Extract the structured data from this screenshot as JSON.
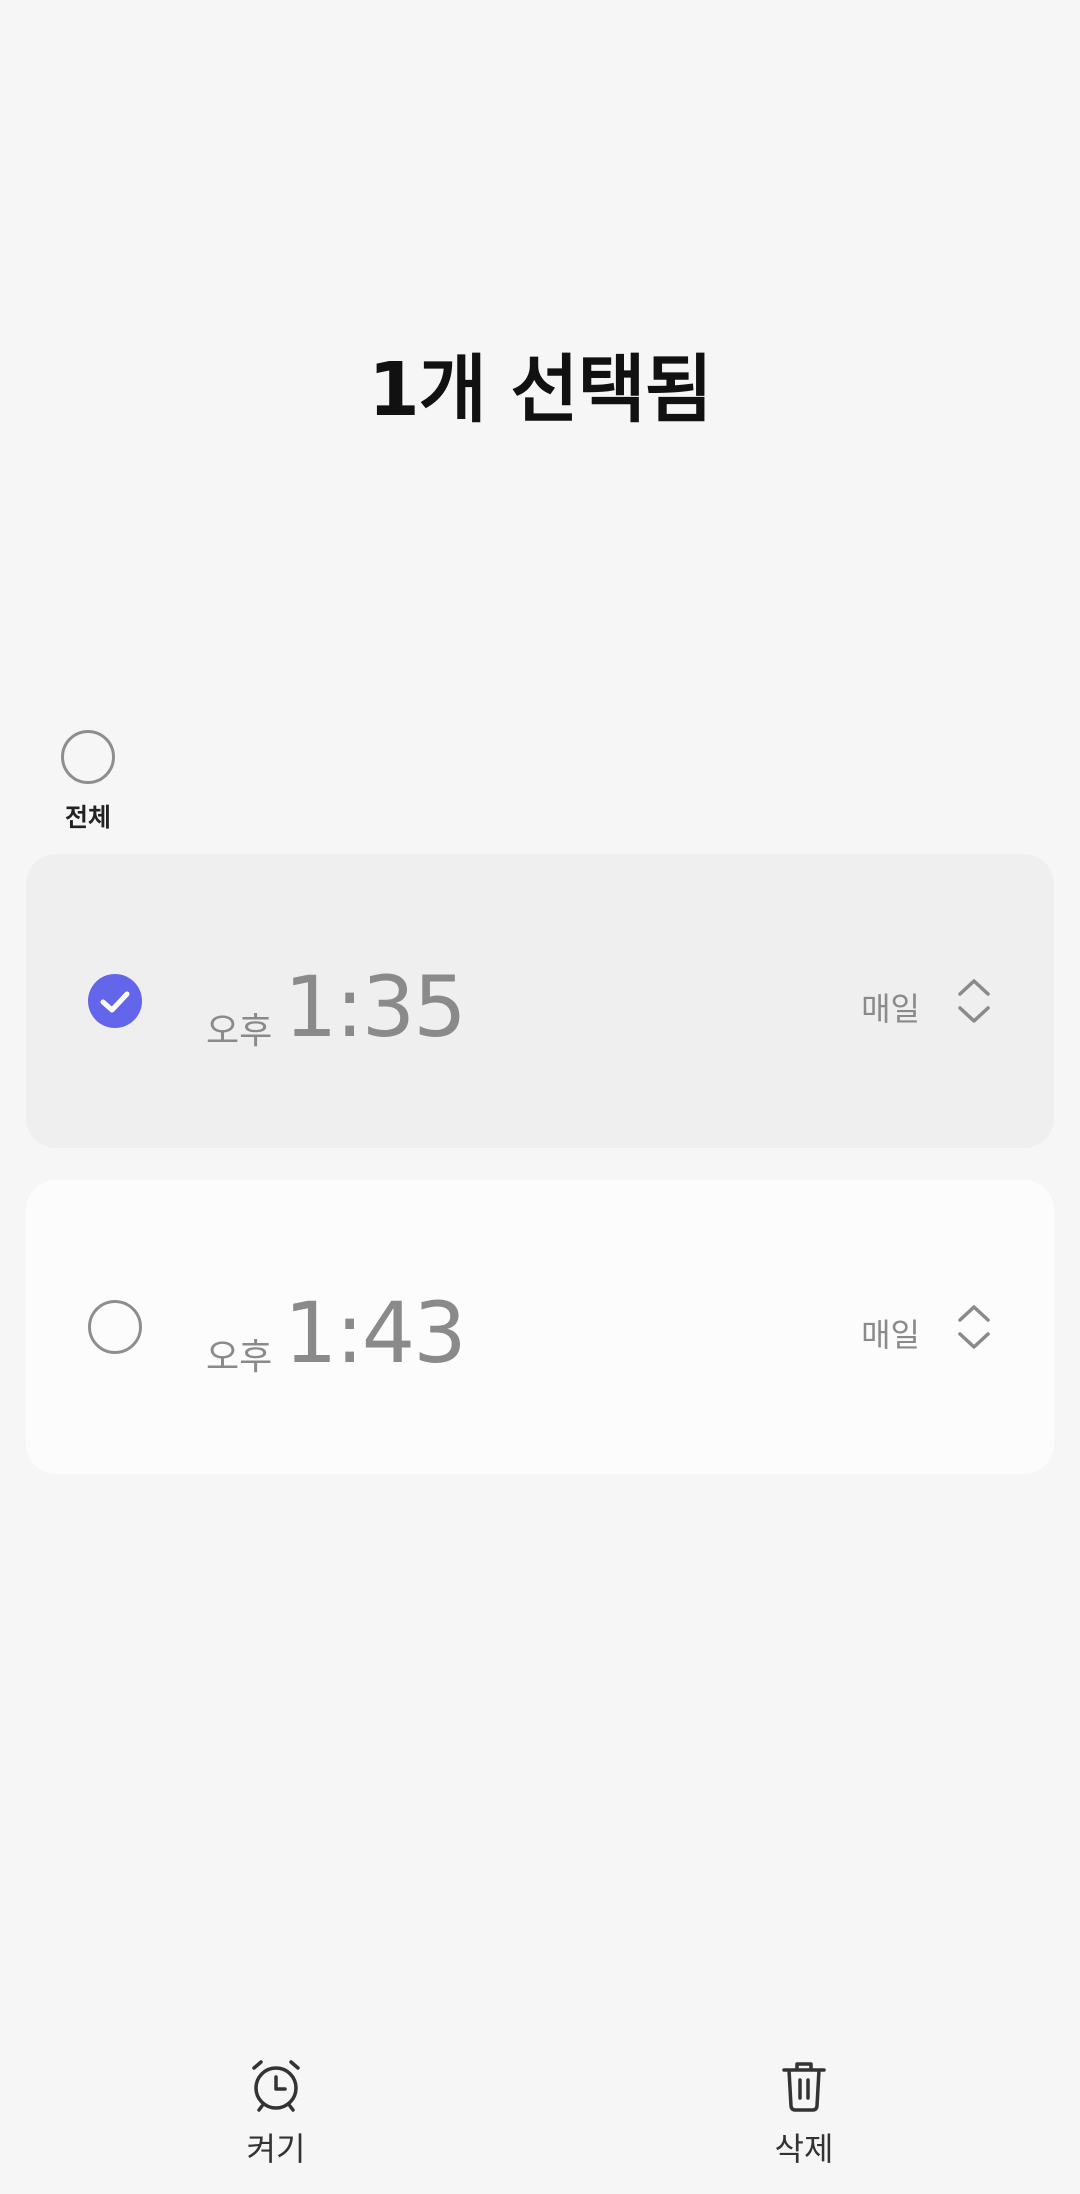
{
  "header": {
    "title": "1개 선택됨"
  },
  "select_all": {
    "label": "전체",
    "checked": false
  },
  "alarms": [
    {
      "ampm": "오후",
      "time": "1:35",
      "repeat": "매일",
      "selected": true
    },
    {
      "ampm": "오후",
      "time": "1:43",
      "repeat": "매일",
      "selected": false
    }
  ],
  "bottom_bar": {
    "turn_on_label": "켜기",
    "delete_label": "삭제"
  },
  "colors": {
    "accent": "#6365ea",
    "background": "#f6f6f6",
    "selected_card": "#efefef",
    "card": "#fcfcfc"
  },
  "icons": {
    "turn_on": "alarm-clock-icon",
    "delete": "trash-icon",
    "expand": "chevron-up-down-icon"
  }
}
